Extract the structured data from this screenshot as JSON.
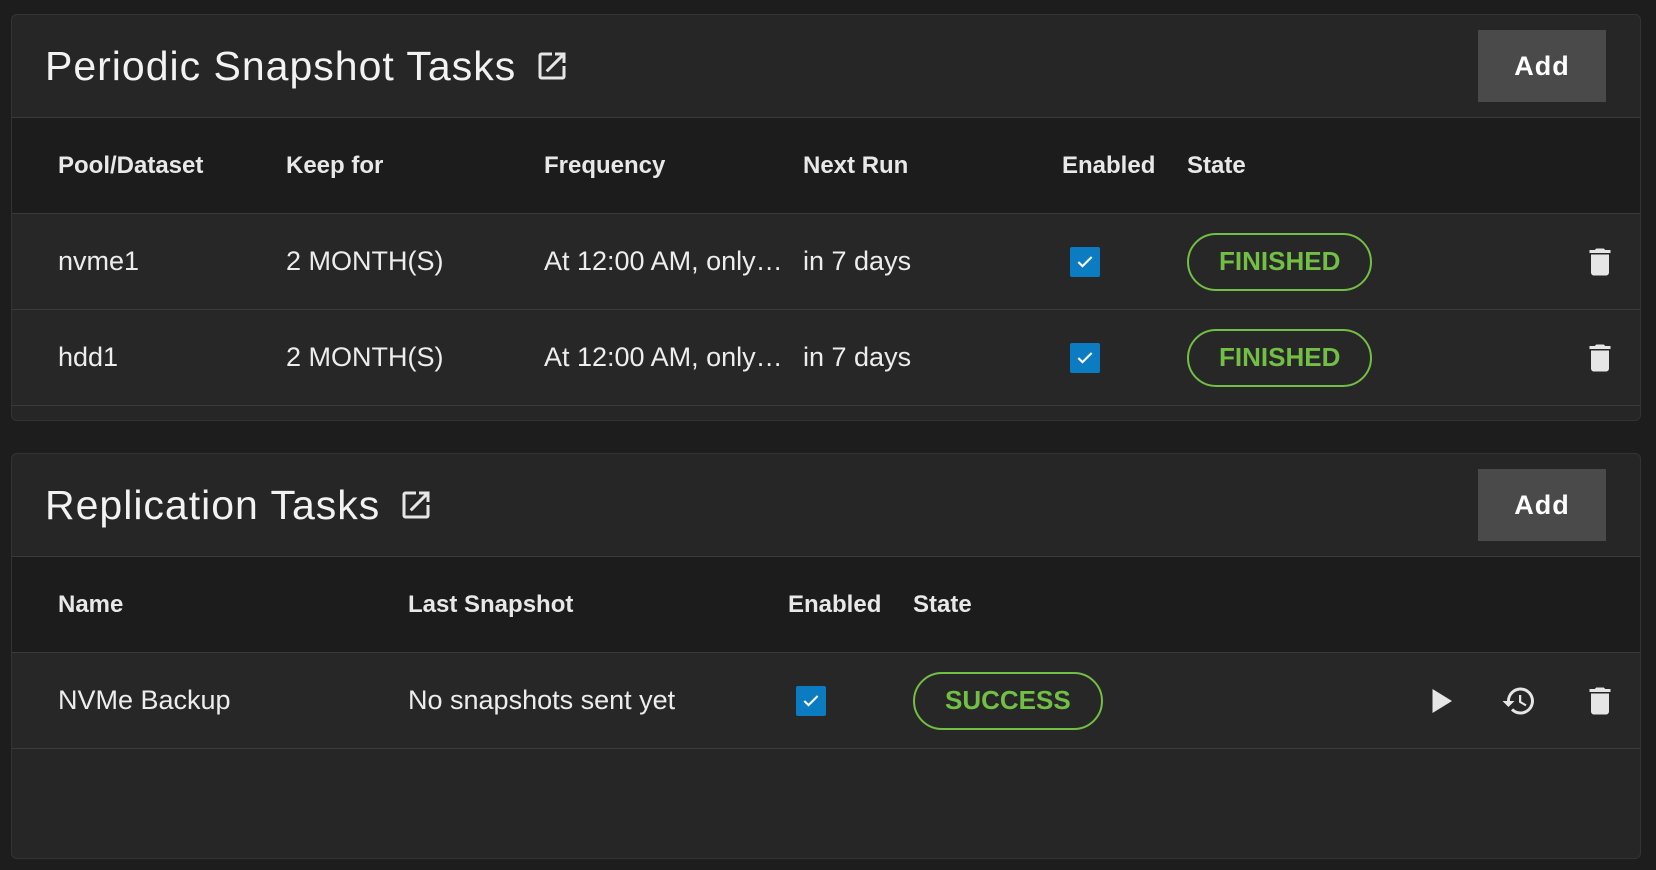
{
  "snapshot_card": {
    "title": "Periodic Snapshot Tasks",
    "add_label": "Add",
    "columns": [
      "Pool/Dataset",
      "Keep for",
      "Frequency",
      "Next Run",
      "Enabled",
      "State"
    ],
    "rows": [
      {
        "dataset": "nvme1",
        "keep_for": "2 MONTH(S)",
        "frequency": "At 12:00 AM, only…",
        "next_run": "in 7 days",
        "enabled": true,
        "state": "FINISHED"
      },
      {
        "dataset": "hdd1",
        "keep_for": "2 MONTH(S)",
        "frequency": "At 12:00 AM, only…",
        "next_run": "in 7 days",
        "enabled": true,
        "state": "FINISHED"
      }
    ]
  },
  "replication_card": {
    "title": "Replication Tasks",
    "add_label": "Add",
    "columns": [
      "Name",
      "Last Snapshot",
      "Enabled",
      "State"
    ],
    "rows": [
      {
        "name": "NVMe Backup",
        "last_snapshot": "No snapshots sent yet",
        "enabled": true,
        "state": "SUCCESS"
      }
    ]
  },
  "colors": {
    "background": "#1d1d1d",
    "card": "#262626",
    "accent_blue": "#0b7cc1",
    "success_green": "#71bf44",
    "button_gray": "#4a4a4a"
  },
  "icons": {
    "external_link": "open-in-new-icon",
    "delete": "trash-icon",
    "run": "play-icon",
    "restore": "history-icon",
    "checked": "checkmark-icon"
  }
}
